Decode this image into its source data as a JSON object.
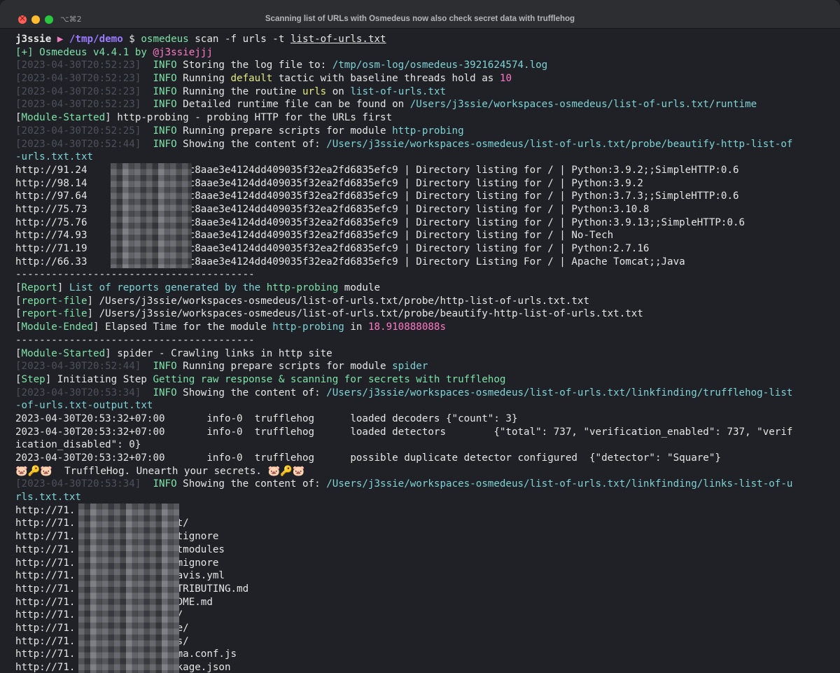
{
  "window": {
    "title": "Scanning list of URLs with Osmedeus now also check secret data with trufflehog",
    "shortcut": "⌥⌘2"
  },
  "prompt": {
    "user": "j3ssie",
    "arrow": " ▶ ",
    "path": "/tmp/demo",
    "dollar": " $ ",
    "cmd": "osmedeus",
    "args": " scan -f urls -t ",
    "target": "list-of-urls.txt"
  },
  "lines": [
    [
      [
        "g",
        "[+] Osmedeus v4.4.1 by "
      ],
      [
        "p",
        "@j3ssiejjj"
      ]
    ],
    [
      [
        "d",
        "[2023-04-30T20:52:23]"
      ],
      [
        "g",
        "  INFO "
      ],
      [
        "w",
        "Storing the log file to: "
      ],
      [
        "c",
        "/tmp/osm-log/osmedeus-3921624574.log"
      ]
    ],
    [
      [
        "d",
        "[2023-04-30T20:52:23]"
      ],
      [
        "g",
        "  INFO "
      ],
      [
        "w",
        "Running "
      ],
      [
        "y",
        "default"
      ],
      [
        "w",
        " tactic with baseline threads hold as "
      ],
      [
        "p",
        "10"
      ]
    ],
    [
      [
        "d",
        "[2023-04-30T20:52:23]"
      ],
      [
        "g",
        "  INFO "
      ],
      [
        "w",
        "Running the routine "
      ],
      [
        "y",
        "urls"
      ],
      [
        "w",
        " on "
      ],
      [
        "c",
        "list-of-urls.txt"
      ]
    ],
    [
      [
        "d",
        "[2023-04-30T20:52:23]"
      ],
      [
        "g",
        "  INFO "
      ],
      [
        "w",
        "Detailed runtime file can be found on "
      ],
      [
        "c",
        "/Users/j3ssie/workspaces-osmedeus/list-of-urls.txt/runtime"
      ]
    ],
    [
      [
        "w",
        "["
      ],
      [
        "g",
        "Module-Started"
      ],
      [
        "w",
        "] http-probing - probing HTTP for the URLs first"
      ]
    ],
    [
      [
        "d",
        "[2023-04-30T20:52:25]"
      ],
      [
        "g",
        "  INFO "
      ],
      [
        "w",
        "Running prepare scripts for module "
      ],
      [
        "c",
        "http-probing"
      ]
    ],
    [
      [
        "d",
        "[2023-04-30T20:52:44]"
      ],
      [
        "g",
        "  INFO "
      ],
      [
        "w",
        "Showing the content of: "
      ],
      [
        "c",
        "/Users/j3ssie/workspaces-osmedeus/list-of-urls.txt/probe/beautify-http-list-of"
      ]
    ],
    [
      [
        "c",
        "-urls.txt.txt"
      ]
    ],
    [
      [
        "w",
        "http://91.24          | 3bc15c8aae3e4124dd409035f32ea2fd6835efc9 | Directory listing for / | Python:3.9.2;;SimpleHTTP:0.6"
      ]
    ],
    [
      [
        "w",
        "http://98.14          | 3bc15c8aae3e4124dd409035f32ea2fd6835efc9 | Directory listing for / | Python:3.9.2"
      ]
    ],
    [
      [
        "w",
        "http://97.64          | 3bc15c8aae3e4124dd409035f32ea2fd6835efc9 | Directory listing for / | Python:3.7.3;;SimpleHTTP:0.6"
      ]
    ],
    [
      [
        "w",
        "http://75.73          | 3bc15c8aae3e4124dd409035f32ea2fd6835efc9 | Directory listing for / | Python:3.10.8"
      ]
    ],
    [
      [
        "w",
        "http://75.76          | 3bc15c8aae3e4124dd409035f32ea2fd6835efc9 | Directory listing for / | Python:3.9.13;;SimpleHTTP:0.6"
      ]
    ],
    [
      [
        "w",
        "http://74.93          | 3bc15c8aae3e4124dd409035f32ea2fd6835efc9 | Directory listing for / | No-Tech"
      ]
    ],
    [
      [
        "w",
        "http://71.19          | 3bc15c8aae3e4124dd409035f32ea2fd6835efc9 | Directory listing for / | Python:2.7.16"
      ]
    ],
    [
      [
        "w",
        "http://66.33          | 3bc15c8aae3e4124dd409035f32ea2fd6835efc9 | Directory Listing For / | Apache Tomcat;;Java"
      ]
    ],
    [
      [
        "w",
        "----------------------------------------"
      ]
    ],
    [
      [
        "w",
        "["
      ],
      [
        "g",
        "Report"
      ],
      [
        "w",
        "] "
      ],
      [
        "c",
        "List of reports generated by the "
      ],
      [
        "g",
        "http-probing"
      ],
      [
        "w",
        " module"
      ]
    ],
    [
      [
        "w",
        "["
      ],
      [
        "g",
        "report-file"
      ],
      [
        "w",
        "] /Users/j3ssie/workspaces-osmedeus/list-of-urls.txt/probe/http-list-of-urls.txt.txt"
      ]
    ],
    [
      [
        "w",
        "["
      ],
      [
        "g",
        "report-file"
      ],
      [
        "w",
        "] /Users/j3ssie/workspaces-osmedeus/list-of-urls.txt/probe/beautify-http-list-of-urls.txt.txt"
      ]
    ],
    [
      [
        "w",
        "["
      ],
      [
        "g",
        "Module-Ended"
      ],
      [
        "w",
        "] Elapsed Time for the module "
      ],
      [
        "c",
        "http-probing"
      ],
      [
        "w",
        " in "
      ],
      [
        "p",
        "18.910888088s"
      ]
    ],
    [
      [
        "w",
        "----------------------------------------"
      ]
    ],
    [
      [
        "w",
        "["
      ],
      [
        "g",
        "Module-Started"
      ],
      [
        "w",
        "] spider - Crawling links in http site"
      ]
    ],
    [
      [
        "d",
        "[2023-04-30T20:52:44]"
      ],
      [
        "g",
        "  INFO "
      ],
      [
        "w",
        "Running prepare scripts for module "
      ],
      [
        "c",
        "spider"
      ]
    ],
    [
      [
        "w",
        "["
      ],
      [
        "g",
        "Step"
      ],
      [
        "w",
        "] Initiating Step "
      ],
      [
        "g",
        "Getting raw response & scanning for secrets with trufflehog"
      ]
    ],
    [
      [
        "d",
        "[2023-04-30T20:53:34]"
      ],
      [
        "g",
        "  INFO "
      ],
      [
        "w",
        "Showing the content of: "
      ],
      [
        "c",
        "/Users/j3ssie/workspaces-osmedeus/list-of-urls.txt/linkfinding/trufflehog-list"
      ]
    ],
    [
      [
        "c",
        "-of-urls.txt-output.txt"
      ]
    ],
    [
      [
        "w",
        "2023-04-30T20:53:32+07:00       info-0  trufflehog      loaded decoders {\"count\": 3}"
      ]
    ],
    [
      [
        "w",
        "2023-04-30T20:53:32+07:00       info-0  trufflehog      loaded detectors        {\"total\": 737, \"verification_enabled\": 737, \"verif"
      ]
    ],
    [
      [
        "w",
        "ication_disabled\": 0}"
      ]
    ],
    [
      [
        "w",
        "2023-04-30T20:53:32+07:00       info-0  trufflehog      possible duplicate detector configured  {\"detector\": \"Square\"}"
      ]
    ],
    [
      [
        "w",
        "🐷🔑🐷  TruffleHog. Unearth your secrets. 🐷🔑🐷"
      ]
    ],
    [
      [
        "d",
        "[2023-04-30T20:53:34]"
      ],
      [
        "g",
        "  INFO "
      ],
      [
        "w",
        "Showing the content of: "
      ],
      [
        "c",
        "/Users/j3ssie/workspaces-osmedeus/list-of-urls.txt/linkfinding/links-list-of-u"
      ]
    ],
    [
      [
        "c",
        "rls.txt.txt"
      ]
    ],
    [
      [
        "w",
        "http://71.           30"
      ]
    ],
    [
      [
        "w",
        "http://71.           30/.git/"
      ]
    ],
    [
      [
        "w",
        "http://71.           30/.gitignore"
      ]
    ],
    [
      [
        "w",
        "http://71.           30/.gitmodules"
      ]
    ],
    [
      [
        "w",
        "http://71.           30/.npmignore"
      ]
    ],
    [
      [
        "w",
        "http://71.           30/.travis.yml"
      ]
    ],
    [
      [
        "w",
        "http://71.           30/CONTRIBUTING.md"
      ]
    ],
    [
      [
        "w",
        "http://71.           30/README.md"
      ]
    ],
    [
      [
        "w",
        "http://71.           30/app/"
      ]
    ],
    [
      [
        "w",
        "http://71.           30/core/"
      ]
    ],
    [
      [
        "w",
        "http://71.           30/docs/"
      ]
    ],
    [
      [
        "w",
        "http://71.           30/karma.conf.js"
      ]
    ],
    [
      [
        "w",
        "http://71.           30/package.json"
      ]
    ]
  ]
}
